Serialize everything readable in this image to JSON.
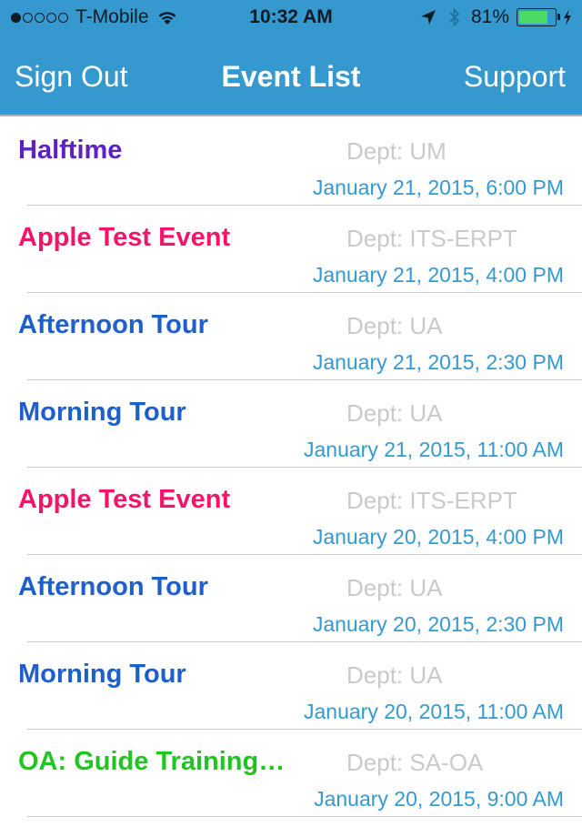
{
  "status_bar": {
    "signal_bars_filled": 1,
    "signal_bars_total": 5,
    "carrier": "T-Mobile",
    "time": "10:32 AM",
    "battery_percent": "81%",
    "battery_level": 0.81,
    "icons": [
      "wifi-icon",
      "location-arrow-icon",
      "bluetooth-icon",
      "battery-icon",
      "charging-bolt-icon"
    ]
  },
  "nav": {
    "left_button": "Sign Out",
    "title": "Event List",
    "right_button": "Support"
  },
  "colors": {
    "header_bg": "#3599cf",
    "date_text": "#3599cf",
    "dept_text": "#cacaca",
    "purple": "#5b22c8",
    "pink": "#f5146a",
    "blue": "#1f5fcc",
    "green": "#22c422"
  },
  "events": [
    {
      "name": "Halftime",
      "dept": "Dept: UM",
      "date": "January 21, 2015, 6:00 PM",
      "color": "#5b22c8"
    },
    {
      "name": "Apple Test Event",
      "dept": "Dept: ITS-ERPT",
      "date": "January 21, 2015, 4:00 PM",
      "color": "#f5146a"
    },
    {
      "name": "Afternoon Tour",
      "dept": "Dept: UA",
      "date": "January 21, 2015, 2:30 PM",
      "color": "#1f5fcc"
    },
    {
      "name": "Morning Tour",
      "dept": "Dept: UA",
      "date": "January 21, 2015, 11:00 AM",
      "color": "#1f5fcc"
    },
    {
      "name": "Apple Test Event",
      "dept": "Dept: ITS-ERPT",
      "date": "January 20, 2015, 4:00 PM",
      "color": "#f5146a"
    },
    {
      "name": "Afternoon Tour",
      "dept": "Dept: UA",
      "date": "January 20, 2015, 2:30 PM",
      "color": "#1f5fcc"
    },
    {
      "name": "Morning Tour",
      "dept": "Dept: UA",
      "date": "January 20, 2015, 11:00 AM",
      "color": "#1f5fcc"
    },
    {
      "name": "OA: Guide Training…",
      "dept": "Dept: SA-OA",
      "date": "January 20, 2015, 9:00 AM",
      "color": "#22c422"
    }
  ]
}
